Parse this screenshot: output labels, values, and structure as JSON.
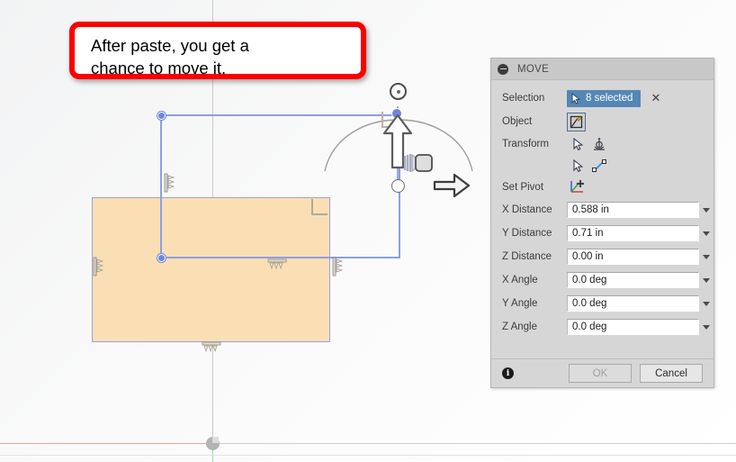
{
  "callout": {
    "line1": "After paste, you get a",
    "line2": "chance to move it.",
    "border_color": "#fb0000"
  },
  "panel": {
    "title": "MOVE",
    "collapse_icon": "collapse-minus-icon",
    "rows": {
      "selection_label": "Selection",
      "selection_value": "8 selected",
      "selection_clear": "✕",
      "object_label": "Object",
      "object_icon": "sketch-object-icon",
      "transform_label": "Transform",
      "transform_option_1": "move-gizmo-icon",
      "transform_option_2": "point-to-point-icon",
      "set_pivot_label": "Set Pivot",
      "set_pivot_icon": "pivot-axes-icon"
    },
    "fields": [
      {
        "label": "X Distance",
        "value": "0.588 in"
      },
      {
        "label": "Y Distance",
        "value": "0.71 in"
      },
      {
        "label": "Z Distance",
        "value": "0.00 in"
      },
      {
        "label": "X Angle",
        "value": "0.0 deg"
      },
      {
        "label": "Y Angle",
        "value": "0.0 deg"
      },
      {
        "label": "Z Angle",
        "value": "0.0 deg"
      }
    ],
    "footer": {
      "info_icon": "info-icon",
      "ok_label": "OK",
      "cancel_label": "Cancel"
    },
    "accent_color": "#5487b5"
  },
  "canvas": {
    "face_color": "#fbdfb4",
    "selection_color": "#8c9ee8",
    "x_axis_color": "#e8a6a0",
    "y_axis_color": "#a8d9a0",
    "gizmo": {
      "arrow_up": "move-arrow-up-handle",
      "rotate_handle": "rotate-handle",
      "plane_handle": "plane-move-handle",
      "origin_handle": "gizmo-origin-point"
    },
    "annotation_arrow": "pointer-arrow-annotation"
  }
}
